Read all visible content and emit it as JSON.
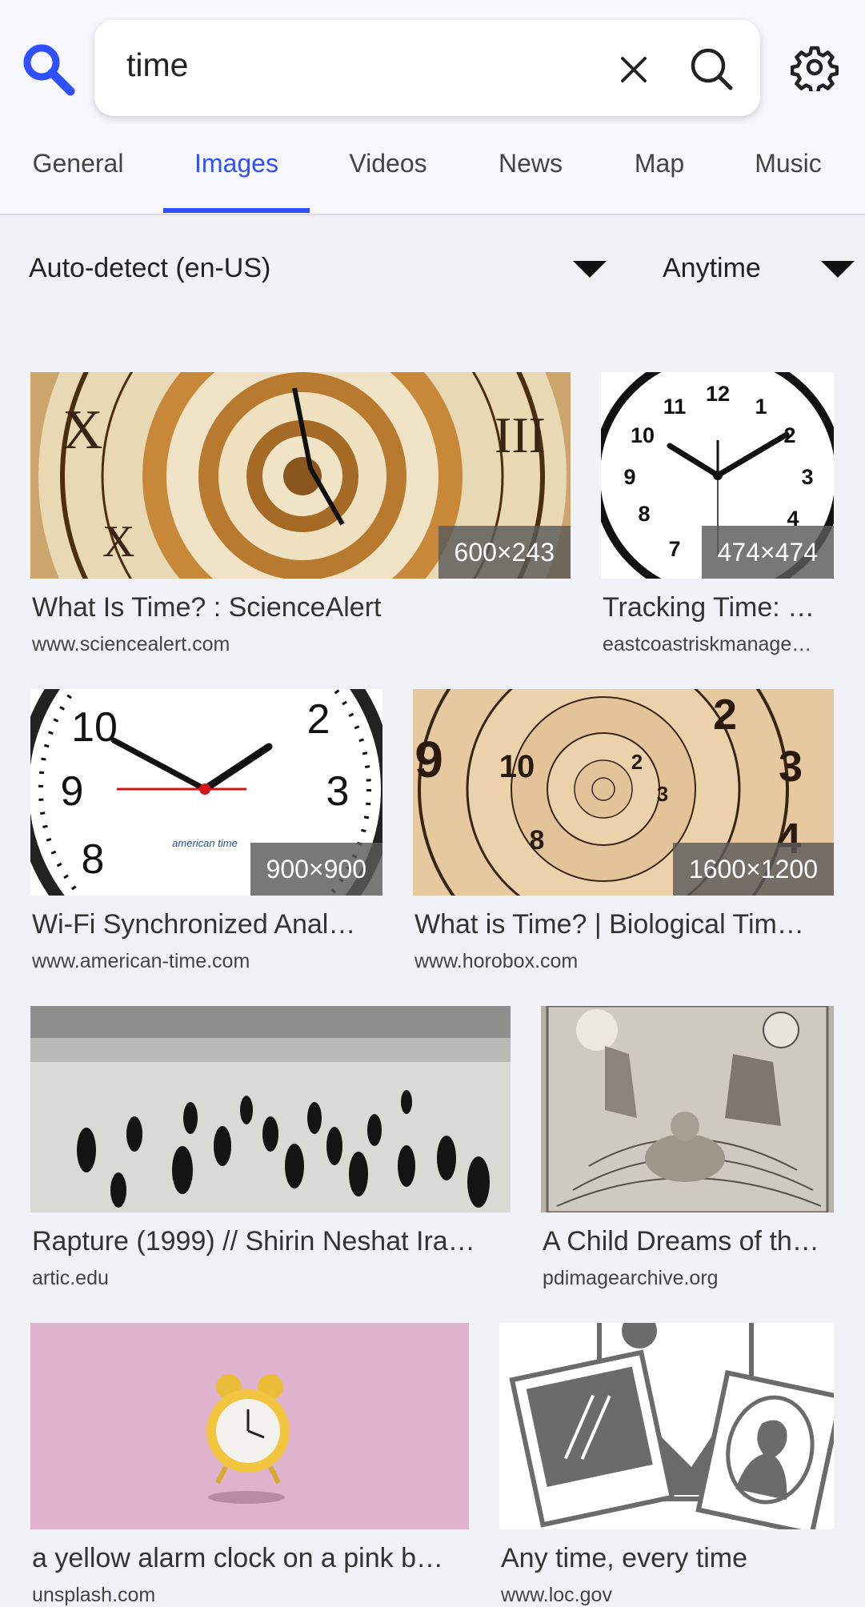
{
  "search": {
    "query": "time",
    "clear_icon": "close-icon",
    "submit_icon": "search-icon",
    "settings_icon": "gear-icon",
    "logo_icon": "magnifier-logo-icon"
  },
  "tabs": [
    {
      "label": "General"
    },
    {
      "label": "Images",
      "active": true
    },
    {
      "label": "Videos"
    },
    {
      "label": "News"
    },
    {
      "label": "Map"
    },
    {
      "label": "Music"
    }
  ],
  "filters": {
    "language": "Auto-detect (en-US)",
    "time_range": "Anytime"
  },
  "colors": {
    "accent": "#3050ff",
    "background": "#f0f2f7",
    "header_bg": "#f7f8fe"
  },
  "results": [
    {
      "title": "What Is Time? : ScienceAlert",
      "url": "www.sciencealert.com",
      "dimensions": "600×243"
    },
    {
      "title": "Tracking Time: …",
      "url": "eastcoastriskmanage…",
      "dimensions": "474×474"
    },
    {
      "title": "Wi-Fi Synchronized Anal…",
      "url": "www.american-time.com",
      "dimensions": "900×900",
      "image_caption": "american time"
    },
    {
      "title": "What is Time? | Biological Tim…",
      "url": "www.horobox.com",
      "dimensions": "1600×1200"
    },
    {
      "title": "Rapture (1999) // Shirin Neshat Ira…",
      "url": "artic.edu"
    },
    {
      "title": "A Child Dreams of th…",
      "url": "pdimagearchive.org"
    },
    {
      "title": "a yellow alarm clock on a pink b…",
      "url": "unsplash.com"
    },
    {
      "title": "Any time, every time",
      "url": "www.loc.gov"
    }
  ]
}
